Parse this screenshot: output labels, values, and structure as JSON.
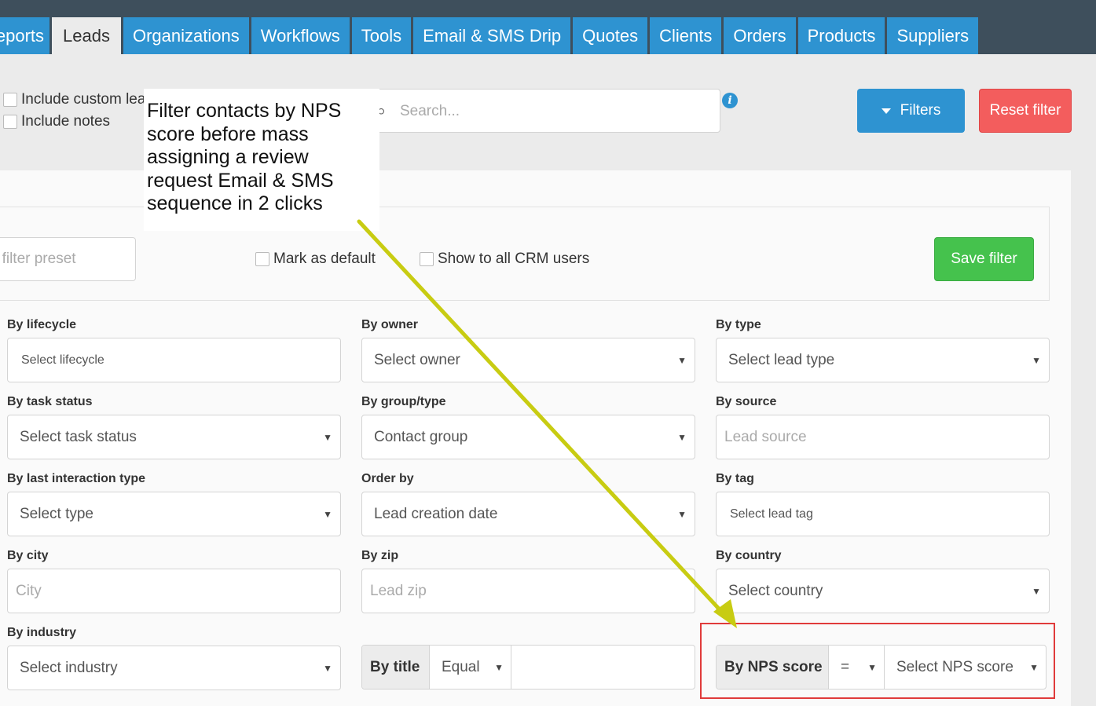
{
  "tabs": [
    {
      "label": "Reports",
      "state": "normal"
    },
    {
      "label": "Leads",
      "state": "active"
    },
    {
      "label": "Organizations",
      "state": "normal"
    },
    {
      "label": "Workflows",
      "state": "normal"
    },
    {
      "label": "Tools",
      "state": "normal"
    },
    {
      "label": "Email & SMS Drip",
      "state": "normal"
    },
    {
      "label": "Quotes",
      "state": "normal"
    },
    {
      "label": "Clients",
      "state": "normal"
    },
    {
      "label": "Orders",
      "state": "normal"
    },
    {
      "label": "Products",
      "state": "normal"
    },
    {
      "label": "Suppliers",
      "state": "normal"
    }
  ],
  "toolbar": {
    "include_custom_label": "Include custom lea",
    "include_notes_label": "Include notes",
    "search_placeholder": "Search...",
    "info_icon": "i",
    "filters_label": "Filters",
    "reset_label": "Reset filter"
  },
  "annotation": {
    "text": "Filter contacts by NPS score before mass assigning a review request Email & SMS sequence in 2 clicks",
    "arrow_color": "#c8cc12"
  },
  "preset": {
    "placeholder": "ew filter preset",
    "mark_default_label": "Mark as default",
    "show_all_label": "Show to all CRM users",
    "save_label": "Save filter"
  },
  "filters": {
    "lifecycle": {
      "label": "By lifecycle",
      "value": "Select lifecycle"
    },
    "owner": {
      "label": "By owner",
      "value": "Select owner"
    },
    "type": {
      "label": "By type",
      "value": "Select lead type"
    },
    "task_status": {
      "label": "By task status",
      "value": "Select task status"
    },
    "group_type": {
      "label": "By group/type",
      "value": "Contact group"
    },
    "source": {
      "label": "By source",
      "placeholder": "Lead source"
    },
    "last_interaction": {
      "label": "By last interaction type",
      "value": "Select type"
    },
    "order_by": {
      "label": "Order by",
      "value": "Lead creation date"
    },
    "tag": {
      "label": "By tag",
      "value": "Select lead tag"
    },
    "city": {
      "label": "By city",
      "placeholder": "City"
    },
    "zip": {
      "label": "By zip",
      "placeholder": "Lead zip"
    },
    "country": {
      "label": "By country",
      "value": "Select country"
    },
    "industry": {
      "label": "By industry",
      "value": "Select industry"
    },
    "title": {
      "addon": "By title",
      "operator": "Equal",
      "value": ""
    },
    "nps": {
      "addon": "By NPS score",
      "operator": "=",
      "value": "Select NPS score"
    }
  },
  "colors": {
    "tab_blue": "#2e93d1",
    "topbar": "#3e4f5c",
    "reset_red": "#f35d5d",
    "save_green": "#45c24d",
    "highlight_red": "#e03b3b"
  }
}
